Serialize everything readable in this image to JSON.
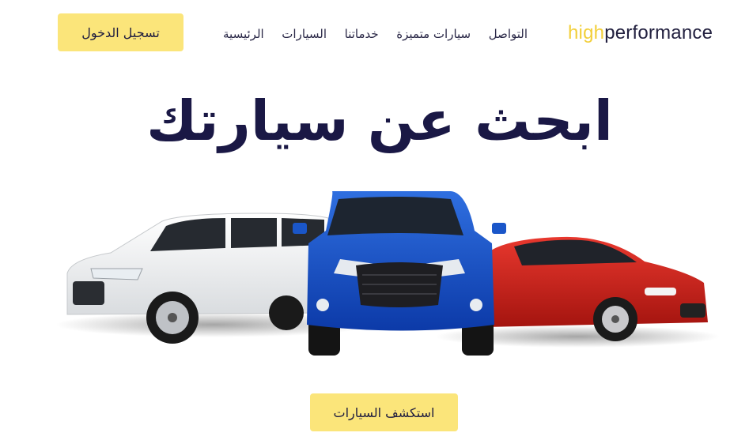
{
  "header": {
    "logo_high": "high",
    "logo_performance": "performance",
    "nav": [
      "الرئيسية",
      "السيارات",
      "خدماتنا",
      "سيارات متميزة",
      "التواصل"
    ],
    "login_label": "تسجيل الدخول"
  },
  "hero": {
    "title": "ابحث عن سيارتك",
    "explore_label": "استكشف السيارات"
  },
  "colors": {
    "accent_yellow": "#fbe57a",
    "logo_yellow": "#f2cf3a",
    "title_navy": "#1a1845"
  },
  "images": {
    "cars": [
      "white-suv",
      "blue-suv",
      "red-sedan"
    ]
  }
}
